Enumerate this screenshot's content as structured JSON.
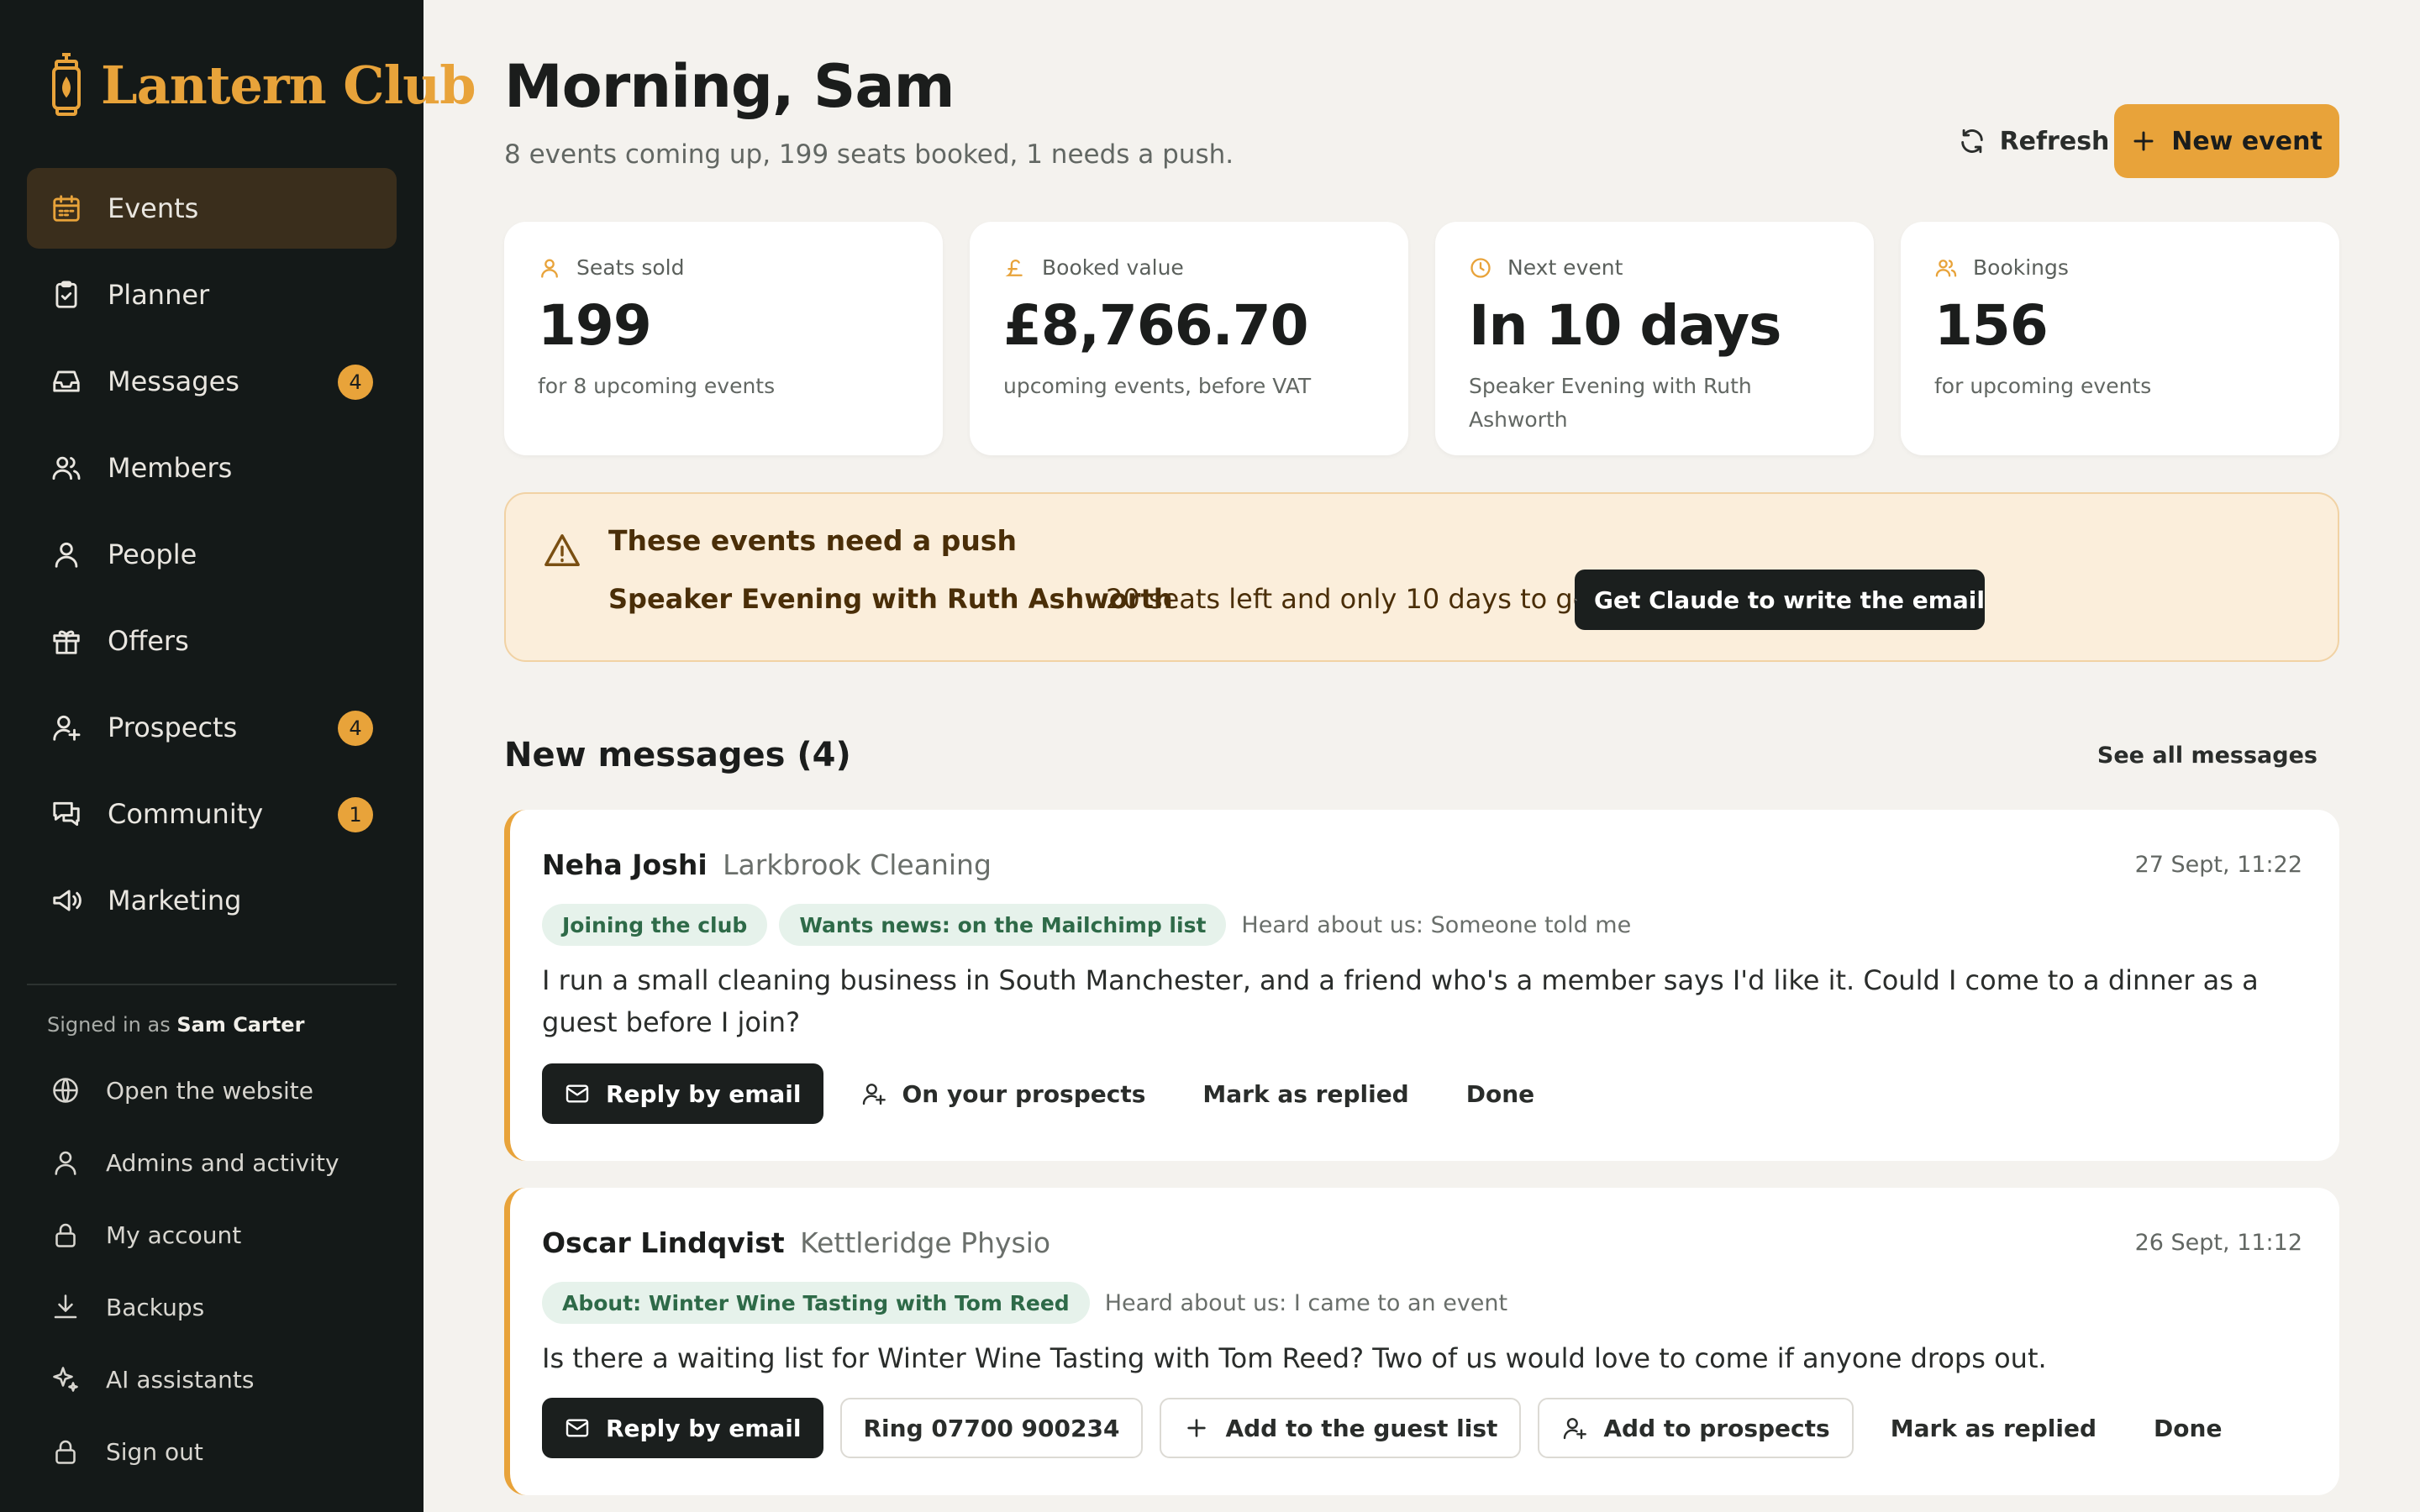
{
  "app": {
    "name": "Lantern Club"
  },
  "nav": [
    {
      "label": "Events",
      "icon": "calendar-icon",
      "active": true
    },
    {
      "label": "Planner",
      "icon": "clipboard-icon"
    },
    {
      "label": "Messages",
      "icon": "inbox-icon",
      "badge": "4"
    },
    {
      "label": "Members",
      "icon": "users-icon"
    },
    {
      "label": "People",
      "icon": "user-icon"
    },
    {
      "label": "Offers",
      "icon": "gift-icon"
    },
    {
      "label": "Prospects",
      "icon": "user-plus-icon",
      "badge": "4"
    },
    {
      "label": "Community",
      "icon": "chat-icon",
      "badge": "1"
    },
    {
      "label": "Marketing",
      "icon": "megaphone-icon"
    }
  ],
  "account": {
    "signed_in_prefix": "Signed in as",
    "user": "Sam Carter",
    "links": [
      {
        "label": "Open the website",
        "icon": "globe-icon"
      },
      {
        "label": "Admins and activity",
        "icon": "user-icon"
      },
      {
        "label": "My account",
        "icon": "lock-icon"
      },
      {
        "label": "Backups",
        "icon": "download-icon"
      },
      {
        "label": "AI assistants",
        "icon": "sparkle-icon"
      },
      {
        "label": "Sign out",
        "icon": "lock-icon"
      }
    ]
  },
  "header": {
    "greeting": "Morning, Sam",
    "summary": "8 events coming up, 199 seats booked, 1 needs a push.",
    "refresh_label": "Refresh",
    "new_event_label": "New event"
  },
  "stats": [
    {
      "label": "Seats sold",
      "value": "199",
      "note": "for 8 upcoming events",
      "icon": "user-icon"
    },
    {
      "label": "Booked value",
      "value": "£8,766.70",
      "note": "upcoming events, before VAT",
      "icon": "pound-icon"
    },
    {
      "label": "Next event",
      "value": "In 10 days",
      "note": "Speaker Evening with Ruth Ashworth",
      "icon": "clock-icon"
    },
    {
      "label": "Bookings",
      "value": "156",
      "note": "for upcoming events",
      "icon": "users-icon"
    }
  ],
  "push": {
    "title": "These events need a push",
    "event": "Speaker Evening with Ruth Ashworth",
    "detail": "20 seats left and only 10 days to go.",
    "button_label": "Get Claude to write the email"
  },
  "messages": {
    "title": "New messages (4)",
    "see_all_label": "See all messages",
    "items": [
      {
        "name": "Neha Joshi",
        "company": "Larkbrook Cleaning",
        "date": "27 Sept, 11:22",
        "tags": [
          "Joining the club",
          "Wants news: on the Mailchimp list"
        ],
        "heard": "Heard about us: Someone told me",
        "body": "I run a small cleaning business in South Manchester, and a friend who's a member says I'd like it. Could I come to a dinner as a guest before I join?",
        "actions": {
          "reply": "Reply by email",
          "prospects": "On your prospects",
          "mark": "Mark as replied",
          "done": "Done"
        }
      },
      {
        "name": "Oscar Lindqvist",
        "company": "Kettleridge Physio",
        "date": "26 Sept, 11:12",
        "tags": [
          "About: Winter Wine Tasting with Tom Reed"
        ],
        "heard": "Heard about us: I came to an event",
        "body": "Is there a waiting list for Winter Wine Tasting with Tom Reed? Two of us would love to come if anyone drops out.",
        "actions": {
          "reply": "Reply by email",
          "ring": "Ring 07700 900234",
          "guest": "Add to the guest list",
          "prospects": "Add to prospects",
          "mark": "Mark as replied",
          "done": "Done"
        }
      }
    ]
  },
  "colors": {
    "accent": "#e8a33a",
    "sidebar": "#141918",
    "background": "#f4f2ee",
    "tag_bg": "#e6f2eb",
    "tag_text": "#2e6a48"
  }
}
